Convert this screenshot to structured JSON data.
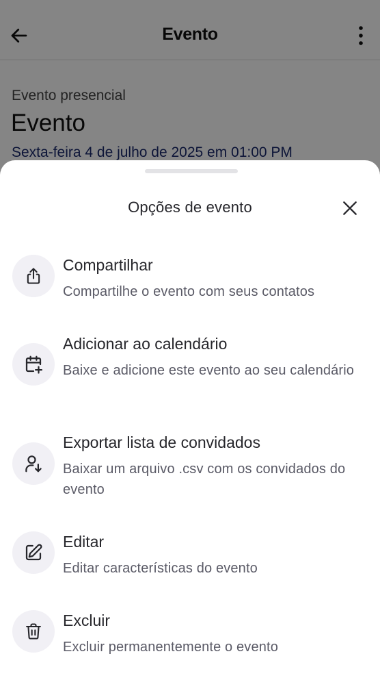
{
  "header": {
    "title": "Evento",
    "back_icon": "arrow-left-icon",
    "menu_icon": "more-vertical-icon"
  },
  "event": {
    "type": "Evento presencial",
    "name": "Evento",
    "date": "Sexta-feira 4 de julho de 2025 em 01:00 PM"
  },
  "sheet": {
    "title": "Opções de evento",
    "close_icon": "close-icon",
    "options": [
      {
        "icon": "share-icon",
        "title": "Compartilhar",
        "description": "Compartilhe o evento com seus contatos"
      },
      {
        "icon": "calendar-add-icon",
        "title": "Adicionar ao calendário",
        "description": "Baixe e adicione este evento ao seu calendário"
      },
      {
        "icon": "user-download-icon",
        "title": "Exportar lista de convidados",
        "description": "Baixar um arquivo .csv com os convidados do evento"
      },
      {
        "icon": "edit-icon",
        "title": "Editar",
        "description": "Editar características do evento"
      },
      {
        "icon": "trash-icon",
        "title": "Excluir",
        "description": "Excluir permanentemente o evento"
      }
    ]
  },
  "colors": {
    "scrim": "#000000",
    "icon_circle": "#f1f0f5",
    "title_text": "#26262b",
    "description_text": "#5a5a66",
    "date_link": "#1a2a6c"
  }
}
